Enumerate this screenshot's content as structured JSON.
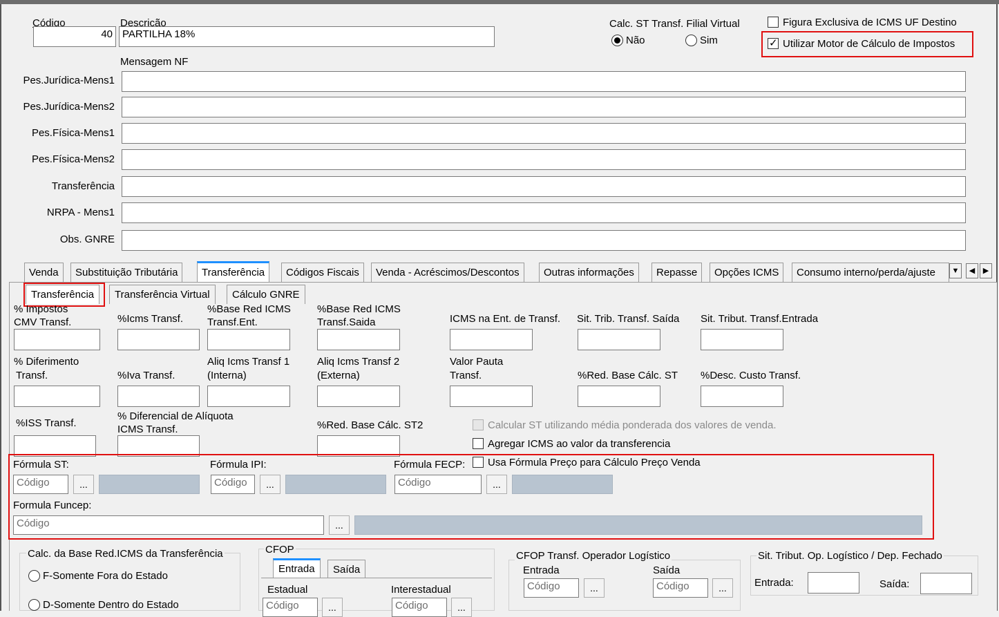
{
  "header": {
    "codigo_label": "Código",
    "codigo_value": "40",
    "descricao_label": "Descrição",
    "descricao_value": "PARTILHA 18%",
    "calc_st_label": "Calc. ST Transf. Filial Virtual",
    "radio_nao": "Não",
    "radio_sim": "Sim",
    "figura_exclusiva": "Figura Exclusiva de ICMS UF Destino",
    "utilizar_motor": "Utilizar Motor de Cálculo de Impostos",
    "mensagem_nf": "Mensagem NF"
  },
  "messages": [
    {
      "label": "Pes.Jurídica-Mens1",
      "value": ""
    },
    {
      "label": "Pes.Jurídica-Mens2",
      "value": ""
    },
    {
      "label": "Pes.Física-Mens1",
      "value": ""
    },
    {
      "label": "Pes.Física-Mens2",
      "value": ""
    },
    {
      "label": "Transferência",
      "value": ""
    },
    {
      "label": "NRPA - Mens1",
      "value": ""
    },
    {
      "label": "Obs. GNRE",
      "value": ""
    }
  ],
  "tabs": [
    "Venda",
    "Substituição Tributária",
    "Transferência",
    "Códigos Fiscais",
    "Venda - Acréscimos/Descontos",
    "Outras informações",
    "Repasse",
    "Opções ICMS",
    "Consumo interno/perda/ajuste"
  ],
  "subtabs": [
    "Transferência",
    "Transferência Virtual",
    "Cálculo GNRE"
  ],
  "fields": {
    "impostos_cmv_1": "% Impostos",
    "impostos_cmv_2": "CMV Transf.",
    "icms_transf": "%Icms Transf.",
    "base_red_ent_1": "%Base Red ICMS",
    "base_red_ent_2": "Transf.Ent.",
    "base_red_saida_1": "%Base Red ICMS",
    "base_red_saida_2": "Transf.Saida",
    "icms_ent_transf": "ICMS na Ent. de Transf.",
    "sit_trib_saida": "Sit. Trib. Transf. Saída",
    "sit_trib_entrada": "Sit. Tribut. Transf.Entrada",
    "diferimento_1": "% Diferimento",
    "diferimento_2": "Transf.",
    "iva_transf": "%Iva Transf.",
    "aliq_1_a": "Aliq Icms Transf 1",
    "aliq_1_b": "(Interna)",
    "aliq_2_a": "Aliq Icms Transf 2",
    "aliq_2_b": "(Externa)",
    "valor_pauta_1": "Valor Pauta",
    "valor_pauta_2": "Transf.",
    "red_base_st": "%Red. Base Cálc. ST",
    "desc_custo": "%Desc. Custo Transf.",
    "iss_transf": "%ISS  Transf.",
    "dif_aliq_1": "% Diferencial de Alíquota",
    "dif_aliq_2": "ICMS Transf.",
    "red_base_st2": "%Red. Base Cálc. ST2",
    "calc_st_media": "Calcular ST utilizando média ponderada dos valores de venda.",
    "agregar_icms": "Agregar ICMS ao valor da transferencia",
    "usa_formula": "Usa Fórmula Preço para Cálculo Preço Venda"
  },
  "formulas": {
    "st_label": "Fórmula ST:",
    "ipi_label": "Fórmula IPI:",
    "fecp_label": "Fórmula FECP:",
    "funcep_label": "Formula Funcep:",
    "placeholder": "Código",
    "ellipsis": "..."
  },
  "bottom": {
    "calc_base_title": "Calc. da Base Red.ICMS da Transferência",
    "opt_fora": "F-Somente Fora do Estado",
    "opt_dentro": "D-Somente Dentro do Estado",
    "cfop_title": "CFOP",
    "cfop_tab_entrada": "Entrada",
    "cfop_tab_saida": "Saída",
    "estadual": "Estadual",
    "interestadual": "Interestadual",
    "cfop_log_title": "CFOP Transf. Operador Logístico",
    "log_entrada": "Entrada",
    "log_saida": "Saída",
    "sit_trib_log_title": "Sit. Tribut. Op. Logístico / Dep. Fechado",
    "sit_entrada": "Entrada:",
    "sit_saida": "Saída:"
  }
}
